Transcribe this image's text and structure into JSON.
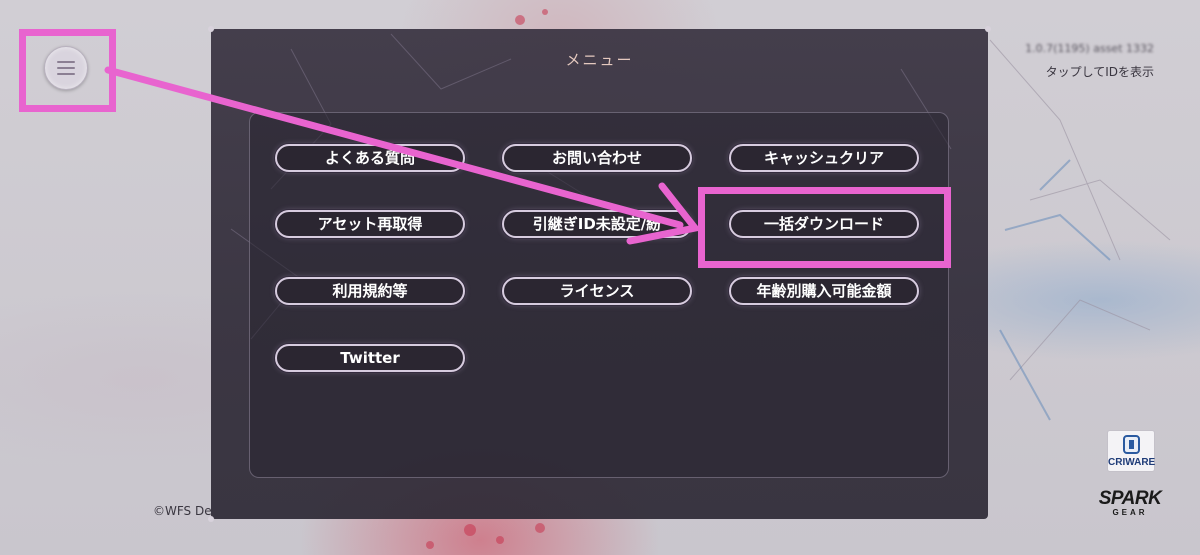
{
  "screen": {
    "version_text": "1.0.7(1195) asset 1332",
    "id_hint": "タップしてIDを表示",
    "copyright": "©WFS De"
  },
  "menu_button": {
    "icon": "hamburger-menu-icon"
  },
  "modal": {
    "title": "メニュー",
    "items": [
      {
        "label": "よくある質問"
      },
      {
        "label": "お問い合わせ"
      },
      {
        "label": "キャッシュクリア"
      },
      {
        "label": "アセット再取得"
      },
      {
        "label": "引継ぎID未設定/紛"
      },
      {
        "label": "一括ダウンロード"
      },
      {
        "label": "利用規約等"
      },
      {
        "label": "ライセンス"
      },
      {
        "label": "年齢別購入可能金額"
      },
      {
        "label": "Twitter"
      }
    ]
  },
  "logos": {
    "cri": "CRIWARE",
    "spark_top": "SPARK",
    "spark_bottom": "GEAR"
  },
  "colors": {
    "annotation": "#e864cf",
    "modal_title": "#e5c9bf",
    "button_border": "#d7ccdf"
  }
}
